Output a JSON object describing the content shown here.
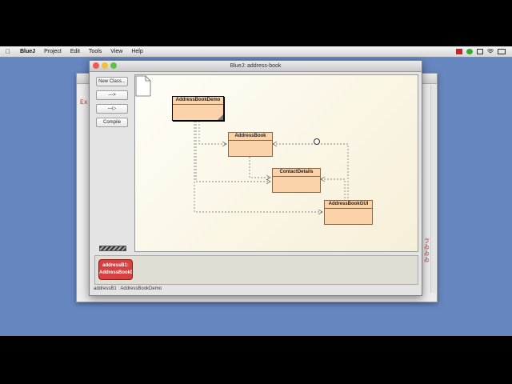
{
  "menubar": {
    "items": [
      "BlueJ",
      "Project",
      "Edit",
      "Tools",
      "View",
      "Help"
    ]
  },
  "background_window": {
    "left_text": "Ex",
    "right_text": "ゔ ゐ ゐ ゐ"
  },
  "window": {
    "title": "BlueJ:  address-book",
    "traffic_light_colors": [
      "#ee5b52",
      "#f3bb3f",
      "#5fc242"
    ]
  },
  "toolbar": {
    "new_class_label": "New Class...",
    "uses_arrow_label": "--->",
    "inherits_arrow_label": "---▷",
    "compile_label": "Compile"
  },
  "diagram": {
    "classes": [
      {
        "name": "AddressBookDemo"
      },
      {
        "name": "AddressBook"
      },
      {
        "name": "ContactDetails"
      },
      {
        "name": "AddressBookGUI"
      }
    ],
    "class_color": "#fcd2a8"
  },
  "object_bench": {
    "object_label_line1": "addressB1:",
    "object_label_line2": "AddressBookD"
  },
  "status_bar": {
    "text": "addressB1 : AddressBookDemo"
  }
}
